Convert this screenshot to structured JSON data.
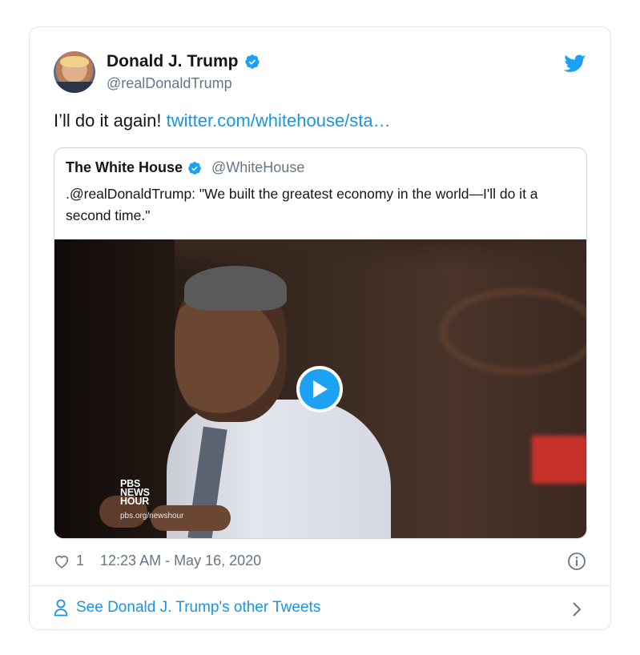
{
  "tweet": {
    "author_name": "Donald J. Trump",
    "author_handle": "@realDonaldTrump",
    "text": "I’ll do it again! ",
    "link_text": "twitter.com/whitehouse/sta…",
    "likes": "1",
    "timestamp": "12:23 AM - May 16, 2020"
  },
  "quoted": {
    "name": "The White House",
    "handle": "@WhiteHouse",
    "text": ".@realDonaldTrump: \"We built the greatest economy in the world—I'll do it a second time.\"",
    "video_watermark_line1": "PBS",
    "video_watermark_line2": "NEWS",
    "video_watermark_line3": "HOUR",
    "video_watermark_url": "pbs.org/newshour"
  },
  "footer": {
    "other_tweets_label": "See Donald J. Trump's other Tweets"
  },
  "icons": {
    "verified": "verified-badge-icon",
    "brand": "twitter-bird-icon",
    "like": "heart-icon",
    "info": "info-icon",
    "profile": "person-icon",
    "next": "chevron-right-icon",
    "play": "play-icon"
  },
  "colors": {
    "accent": "#1da1f2",
    "link": "#1b95e0",
    "secondary_text": "#657786",
    "border": "#e1e8ed"
  }
}
